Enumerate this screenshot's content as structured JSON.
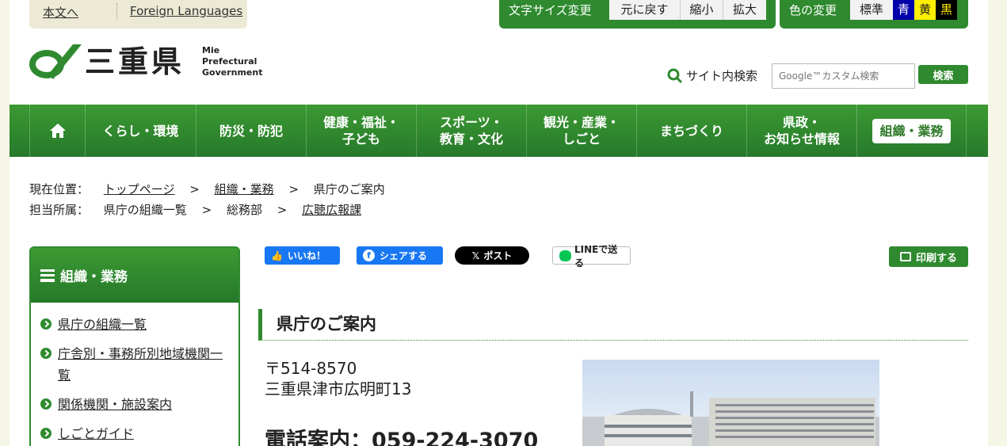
{
  "topbar": {
    "skip_link": "本文へ",
    "foreign_link": "Foreign Languages",
    "font_size": {
      "label": "文字サイズ変更",
      "reset": "元に戻す",
      "smaller": "縮小",
      "larger": "拡大"
    },
    "color_change": {
      "label": "色の変更",
      "standard": "標準",
      "blue": "青",
      "yellow": "黄",
      "black": "黒"
    }
  },
  "header": {
    "logo_ja": "三重県",
    "logo_en_1": "Mie",
    "logo_en_2": "Prefectural",
    "logo_en_3": "Government",
    "search_label": "サイト内検索",
    "search_placeholder": "Google™カスタム検索",
    "search_button": "検索"
  },
  "gnav": [
    {
      "label": "くらし・環境"
    },
    {
      "label": "防災・防犯"
    },
    {
      "label": "健康・福祉・\n子ども"
    },
    {
      "label": "スポーツ・\n教育・文化"
    },
    {
      "label": "観光・産業・\nしごと"
    },
    {
      "label": "まちづくり"
    },
    {
      "label": "県政・\nお知らせ情報"
    },
    {
      "label": "組織・業務"
    }
  ],
  "breadcrumb": {
    "current_label": "現在位置：",
    "top": "トップページ",
    "sep": ">",
    "org": "組織・業務",
    "page": "県庁のご案内",
    "dept_label": "担当所属：",
    "dept_1": "県庁の組織一覧",
    "dept_2": "総務部",
    "dept_3": "広聴広報課"
  },
  "sidebar": {
    "title": "組織・業務",
    "items": [
      {
        "label": "県庁の組織一覧"
      },
      {
        "label": "庁舎別・事務所別地域機関一覧"
      },
      {
        "label": "関係機関・施設案内"
      },
      {
        "label": "しごとガイド"
      }
    ]
  },
  "social": {
    "like": "いいね！",
    "share": "シェアする",
    "post": "ポスト",
    "line": "LINEで送る",
    "print": "印刷する"
  },
  "main": {
    "heading": "県庁のご案内",
    "postal": "〒514-8570",
    "address": "三重県津市広明町13",
    "tel": "電話案内：059-224-3070"
  },
  "colors": {
    "brand_green": "#2f8a2f",
    "blue_bg": "#0000aa",
    "yellow_bg": "#ffee00",
    "black_bg": "#000000"
  }
}
